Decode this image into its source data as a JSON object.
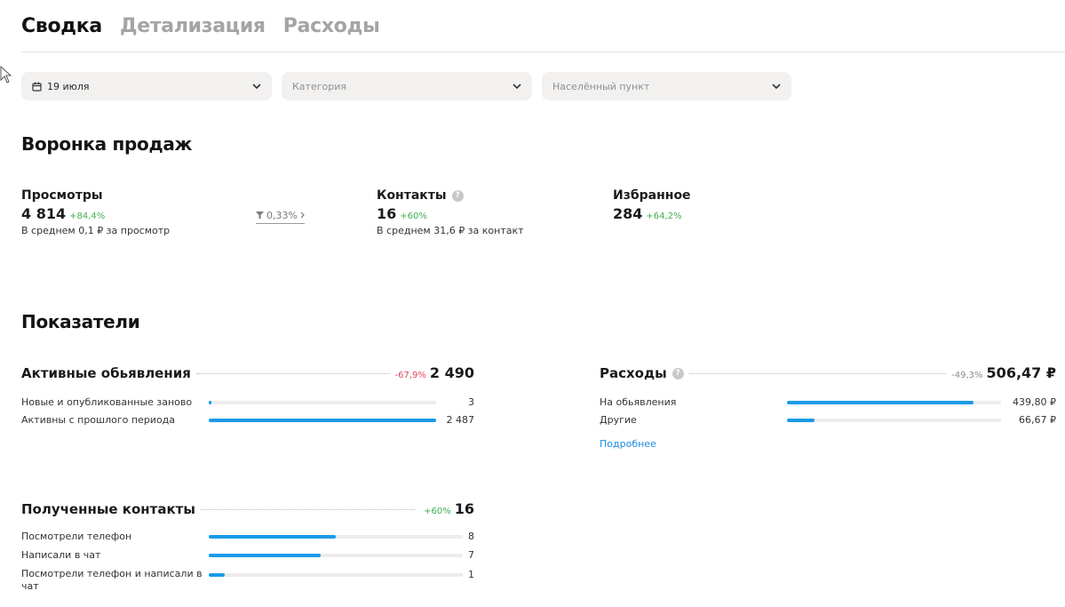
{
  "tabs": [
    {
      "label": "Сводка",
      "active": true
    },
    {
      "label": "Детализация",
      "active": false
    },
    {
      "label": "Расходы",
      "active": false
    }
  ],
  "filters": {
    "date": {
      "value": "19 июля"
    },
    "category": {
      "placeholder": "Категория"
    },
    "locality": {
      "placeholder": "Населённый пункт"
    }
  },
  "funnel": {
    "title": "Воронка продаж",
    "views": {
      "label": "Просмотры",
      "value": "4 814",
      "delta": "+84,4%",
      "sub": "В среднем 0,1 ₽ за просмотр"
    },
    "conversion": {
      "label": "0,33%"
    },
    "contacts": {
      "label": "Контакты",
      "value": "16",
      "delta": "+60%",
      "sub": "В среднем 31,6 ₽ за контакт"
    },
    "favorites": {
      "label": "Избранное",
      "value": "284",
      "delta": "+64,2%"
    }
  },
  "metrics": {
    "title": "Показатели",
    "active_ads": {
      "title": "Активные обьявления",
      "delta": "-67,9%",
      "total": "2 490",
      "rows": [
        {
          "label": "Новые и опубликованные заново",
          "value": "3",
          "fraction": 0.012
        },
        {
          "label": "Активны с прошлого периода",
          "value": "2 487",
          "fraction": 0.999
        }
      ]
    },
    "expenses": {
      "title": "Расходы",
      "delta": "-49,3%",
      "total": "506,47 ₽",
      "rows": [
        {
          "label": "На обьявления",
          "value": "439,80 ₽",
          "fraction": 0.87
        },
        {
          "label": "Другие",
          "value": "66,67 ₽",
          "fraction": 0.13
        }
      ],
      "link": "Подробнее"
    },
    "contacts_received": {
      "title": "Полученные контакты",
      "delta": "+60%",
      "total": "16",
      "rows": [
        {
          "label": "Посмотрели телефон",
          "value": "8",
          "fraction": 0.5
        },
        {
          "label": "Написали в чат",
          "value": "7",
          "fraction": 0.44
        },
        {
          "label": "Посмотрели телефон и написали в чат",
          "value": "1",
          "fraction": 0.063
        }
      ]
    }
  },
  "colors": {
    "accent": "#1a9ae8",
    "positive": "#3fb04f",
    "negative": "#e0485a"
  }
}
